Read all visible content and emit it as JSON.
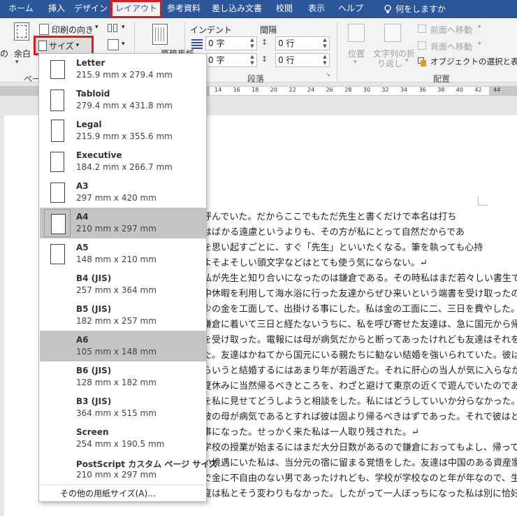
{
  "tabs": [
    {
      "label": "ホーム",
      "active": false
    },
    {
      "label": "挿入",
      "active": false
    },
    {
      "label": "デザイン",
      "active": false
    },
    {
      "label": "レイアウト",
      "active": true
    },
    {
      "label": "参考資料",
      "active": false
    },
    {
      "label": "差し込み文書",
      "active": false
    },
    {
      "label": "校閲",
      "active": false
    },
    {
      "label": "表示",
      "active": false
    },
    {
      "label": "ヘルプ",
      "active": false
    }
  ],
  "tell_me": "何をしますか",
  "ribbon": {
    "margins_label": "余白",
    "orientation_label": "印刷の向き",
    "size_label": "サイズ",
    "partial_left": "の",
    "partial_group": "ペー",
    "manuscript_label": "原稿用紙",
    "indent_label": "インデント",
    "spacing_label": "間隔",
    "indent_left_value": "0 字",
    "indent_right_value": "0 字",
    "spacing_before_value": "0 行",
    "spacing_after_value": "0 行",
    "paragraph_group": "段落",
    "position_label": "位置",
    "wrap_label_1": "文字列の折",
    "wrap_label_2": "り返し",
    "bring_forward": "前面へ移動",
    "send_backward": "背面へ移動",
    "selection_pane": "オブジェクトの選択と表示",
    "arrange_group": "配置"
  },
  "ruler_ticks": [
    "14",
    "16",
    "18",
    "20",
    "22",
    "24",
    "26",
    "28",
    "30",
    "32",
    "34",
    "36",
    "38",
    "40",
    "42",
    "44"
  ],
  "paper_sizes": [
    {
      "name": "Letter",
      "dims": "215.9 mm x 279.4 mm",
      "selected": false,
      "aspect": 1.29
    },
    {
      "name": "Tabloid",
      "dims": "279.4 mm x 431.8 mm",
      "selected": false,
      "aspect": 1.55
    },
    {
      "name": "Legal",
      "dims": "215.9 mm x 355.6 mm",
      "selected": false,
      "aspect": 1.65
    },
    {
      "name": "Executive",
      "dims": "184.2 mm x 266.7 mm",
      "selected": false,
      "aspect": 1.45
    },
    {
      "name": "A3",
      "dims": "297 mm x 420 mm",
      "selected": false,
      "aspect": 1.41
    },
    {
      "name": "A4",
      "dims": "210 mm x 297 mm",
      "selected": true,
      "aspect": 1.41
    },
    {
      "name": "A5",
      "dims": "148 mm x 210 mm",
      "selected": false,
      "aspect": 1.41
    },
    {
      "name": "B4 (JIS)",
      "dims": "257 mm x 364 mm",
      "selected": false,
      "aspect": 0
    },
    {
      "name": "B5 (JIS)",
      "dims": "182 mm x 257 mm",
      "selected": false,
      "aspect": 0
    },
    {
      "name": "A6",
      "dims": "105 mm x 148 mm",
      "selected": true,
      "aspect": 0
    },
    {
      "name": "B6 (JIS)",
      "dims": "128 mm x 182 mm",
      "selected": false,
      "aspect": 0
    },
    {
      "name": "B3 (JIS)",
      "dims": "364 mm x 515 mm",
      "selected": false,
      "aspect": 0
    },
    {
      "name": "Screen",
      "dims": "254 mm x 190.5 mm",
      "selected": false,
      "aspect": 0
    },
    {
      "name": "PostScript カスタム ページ サイズ",
      "dims": "210 mm x 297 mm",
      "selected": false,
      "aspect": 0
    }
  ],
  "more_sizes": "その他の用紙サイズ(A)...",
  "document_lines": [
    "呼んでいた。だからここでもただ先生と書くだけで本名は打ち",
    "はばかる遠慮というよりも、その方が私にとって自然だからであ",
    "を思い起すごとに、すぐ「先生」といいたくなる。筆を執っても心持",
    "よそよそしい頭文字などはとても使う気にならない。↵",
    "私が先生と知り合いになったのは鎌倉である。その時私はまだ若々しい書生であった。暑",
    "中休暇を利用して海水浴に行った友達からぜひ来いという端書を受け取ったので、私は多",
    "少の金を工面して、出掛ける事にした。私は金の工面に二、三日を費やした。ところが私が",
    "鎌倉に着いて三日と経たないうちに、私を呼び寄せた友達は、急に国元から帰れという電報",
    "を受け取った。電報には母が病気だからと断ってあったけれども友達はそれを信じなかっ",
    "た。友達はかねてから国元にいる親たちに勧ない結婚を強いられていた。彼は現代の習慣か",
    "らいうと結婚するにはあまり年が若過ぎた。それに肝心の当人が気に入らなかった。それで",
    "夏休みに当然帰るべきところを、わざと避けて東京の近くで遊んでいたのである。彼は電報",
    "を私に見せてどうしようと相談をした。私にはどうしていいか分らなかった。けれども実際",
    "彼の母が病気であるとすれば彼は固より帰るべきはずであった。それで彼はとうとう帰る",
    "事になった。せっかく来た私は一人取り残された。↵",
    "学校の授業が始まるにはまだ大分日数があるので鎌倉におってもよし、帰ってもよ",
    "い境遇にいた私は、当分元の宿に留まる覚悟をした。友達は中国のある資産家の息子",
    "で金に不自由のない男であったけれども、学校が学校なのと年が年なので、生活の程",
    "度は私とそう変わりもなかった。したがって一人ぼっちになった私は別に恰好な宿を探す面"
  ],
  "colors": {
    "brand": "#2b579a",
    "highlight": "#e0191f",
    "selected_row": "#c4c4c4"
  }
}
